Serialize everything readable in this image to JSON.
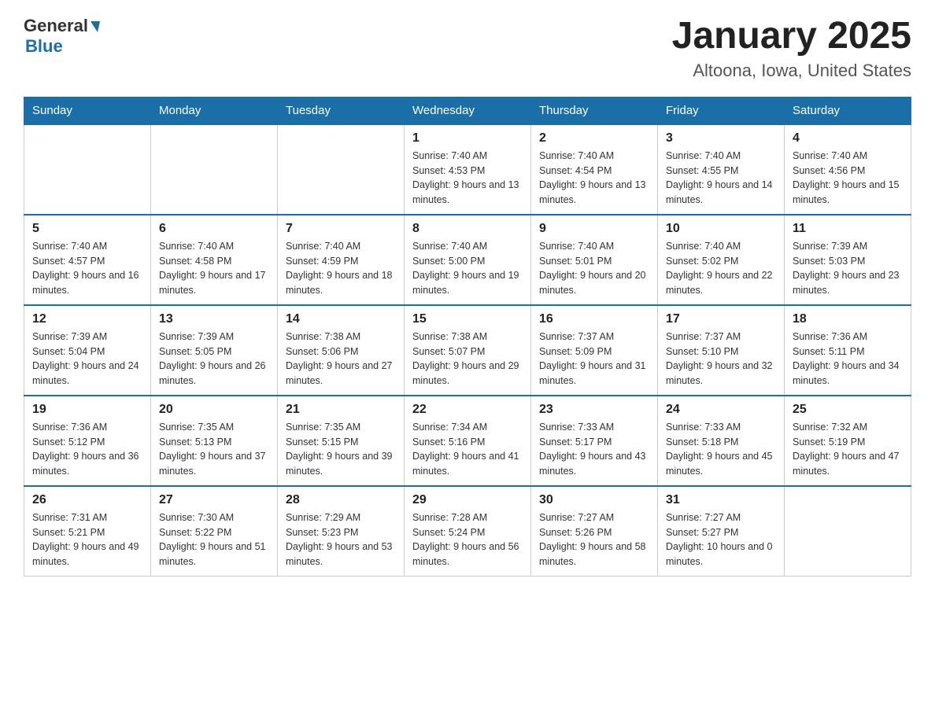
{
  "header": {
    "logo_general": "General",
    "logo_blue": "Blue",
    "title": "January 2025",
    "subtitle": "Altoona, Iowa, United States"
  },
  "weekdays": [
    "Sunday",
    "Monday",
    "Tuesday",
    "Wednesday",
    "Thursday",
    "Friday",
    "Saturday"
  ],
  "weeks": [
    [
      {
        "day": "",
        "info": ""
      },
      {
        "day": "",
        "info": ""
      },
      {
        "day": "",
        "info": ""
      },
      {
        "day": "1",
        "info": "Sunrise: 7:40 AM\nSunset: 4:53 PM\nDaylight: 9 hours\nand 13 minutes."
      },
      {
        "day": "2",
        "info": "Sunrise: 7:40 AM\nSunset: 4:54 PM\nDaylight: 9 hours\nand 13 minutes."
      },
      {
        "day": "3",
        "info": "Sunrise: 7:40 AM\nSunset: 4:55 PM\nDaylight: 9 hours\nand 14 minutes."
      },
      {
        "day": "4",
        "info": "Sunrise: 7:40 AM\nSunset: 4:56 PM\nDaylight: 9 hours\nand 15 minutes."
      }
    ],
    [
      {
        "day": "5",
        "info": "Sunrise: 7:40 AM\nSunset: 4:57 PM\nDaylight: 9 hours\nand 16 minutes."
      },
      {
        "day": "6",
        "info": "Sunrise: 7:40 AM\nSunset: 4:58 PM\nDaylight: 9 hours\nand 17 minutes."
      },
      {
        "day": "7",
        "info": "Sunrise: 7:40 AM\nSunset: 4:59 PM\nDaylight: 9 hours\nand 18 minutes."
      },
      {
        "day": "8",
        "info": "Sunrise: 7:40 AM\nSunset: 5:00 PM\nDaylight: 9 hours\nand 19 minutes."
      },
      {
        "day": "9",
        "info": "Sunrise: 7:40 AM\nSunset: 5:01 PM\nDaylight: 9 hours\nand 20 minutes."
      },
      {
        "day": "10",
        "info": "Sunrise: 7:40 AM\nSunset: 5:02 PM\nDaylight: 9 hours\nand 22 minutes."
      },
      {
        "day": "11",
        "info": "Sunrise: 7:39 AM\nSunset: 5:03 PM\nDaylight: 9 hours\nand 23 minutes."
      }
    ],
    [
      {
        "day": "12",
        "info": "Sunrise: 7:39 AM\nSunset: 5:04 PM\nDaylight: 9 hours\nand 24 minutes."
      },
      {
        "day": "13",
        "info": "Sunrise: 7:39 AM\nSunset: 5:05 PM\nDaylight: 9 hours\nand 26 minutes."
      },
      {
        "day": "14",
        "info": "Sunrise: 7:38 AM\nSunset: 5:06 PM\nDaylight: 9 hours\nand 27 minutes."
      },
      {
        "day": "15",
        "info": "Sunrise: 7:38 AM\nSunset: 5:07 PM\nDaylight: 9 hours\nand 29 minutes."
      },
      {
        "day": "16",
        "info": "Sunrise: 7:37 AM\nSunset: 5:09 PM\nDaylight: 9 hours\nand 31 minutes."
      },
      {
        "day": "17",
        "info": "Sunrise: 7:37 AM\nSunset: 5:10 PM\nDaylight: 9 hours\nand 32 minutes."
      },
      {
        "day": "18",
        "info": "Sunrise: 7:36 AM\nSunset: 5:11 PM\nDaylight: 9 hours\nand 34 minutes."
      }
    ],
    [
      {
        "day": "19",
        "info": "Sunrise: 7:36 AM\nSunset: 5:12 PM\nDaylight: 9 hours\nand 36 minutes."
      },
      {
        "day": "20",
        "info": "Sunrise: 7:35 AM\nSunset: 5:13 PM\nDaylight: 9 hours\nand 37 minutes."
      },
      {
        "day": "21",
        "info": "Sunrise: 7:35 AM\nSunset: 5:15 PM\nDaylight: 9 hours\nand 39 minutes."
      },
      {
        "day": "22",
        "info": "Sunrise: 7:34 AM\nSunset: 5:16 PM\nDaylight: 9 hours\nand 41 minutes."
      },
      {
        "day": "23",
        "info": "Sunrise: 7:33 AM\nSunset: 5:17 PM\nDaylight: 9 hours\nand 43 minutes."
      },
      {
        "day": "24",
        "info": "Sunrise: 7:33 AM\nSunset: 5:18 PM\nDaylight: 9 hours\nand 45 minutes."
      },
      {
        "day": "25",
        "info": "Sunrise: 7:32 AM\nSunset: 5:19 PM\nDaylight: 9 hours\nand 47 minutes."
      }
    ],
    [
      {
        "day": "26",
        "info": "Sunrise: 7:31 AM\nSunset: 5:21 PM\nDaylight: 9 hours\nand 49 minutes."
      },
      {
        "day": "27",
        "info": "Sunrise: 7:30 AM\nSunset: 5:22 PM\nDaylight: 9 hours\nand 51 minutes."
      },
      {
        "day": "28",
        "info": "Sunrise: 7:29 AM\nSunset: 5:23 PM\nDaylight: 9 hours\nand 53 minutes."
      },
      {
        "day": "29",
        "info": "Sunrise: 7:28 AM\nSunset: 5:24 PM\nDaylight: 9 hours\nand 56 minutes."
      },
      {
        "day": "30",
        "info": "Sunrise: 7:27 AM\nSunset: 5:26 PM\nDaylight: 9 hours\nand 58 minutes."
      },
      {
        "day": "31",
        "info": "Sunrise: 7:27 AM\nSunset: 5:27 PM\nDaylight: 10 hours\nand 0 minutes."
      },
      {
        "day": "",
        "info": ""
      }
    ]
  ]
}
